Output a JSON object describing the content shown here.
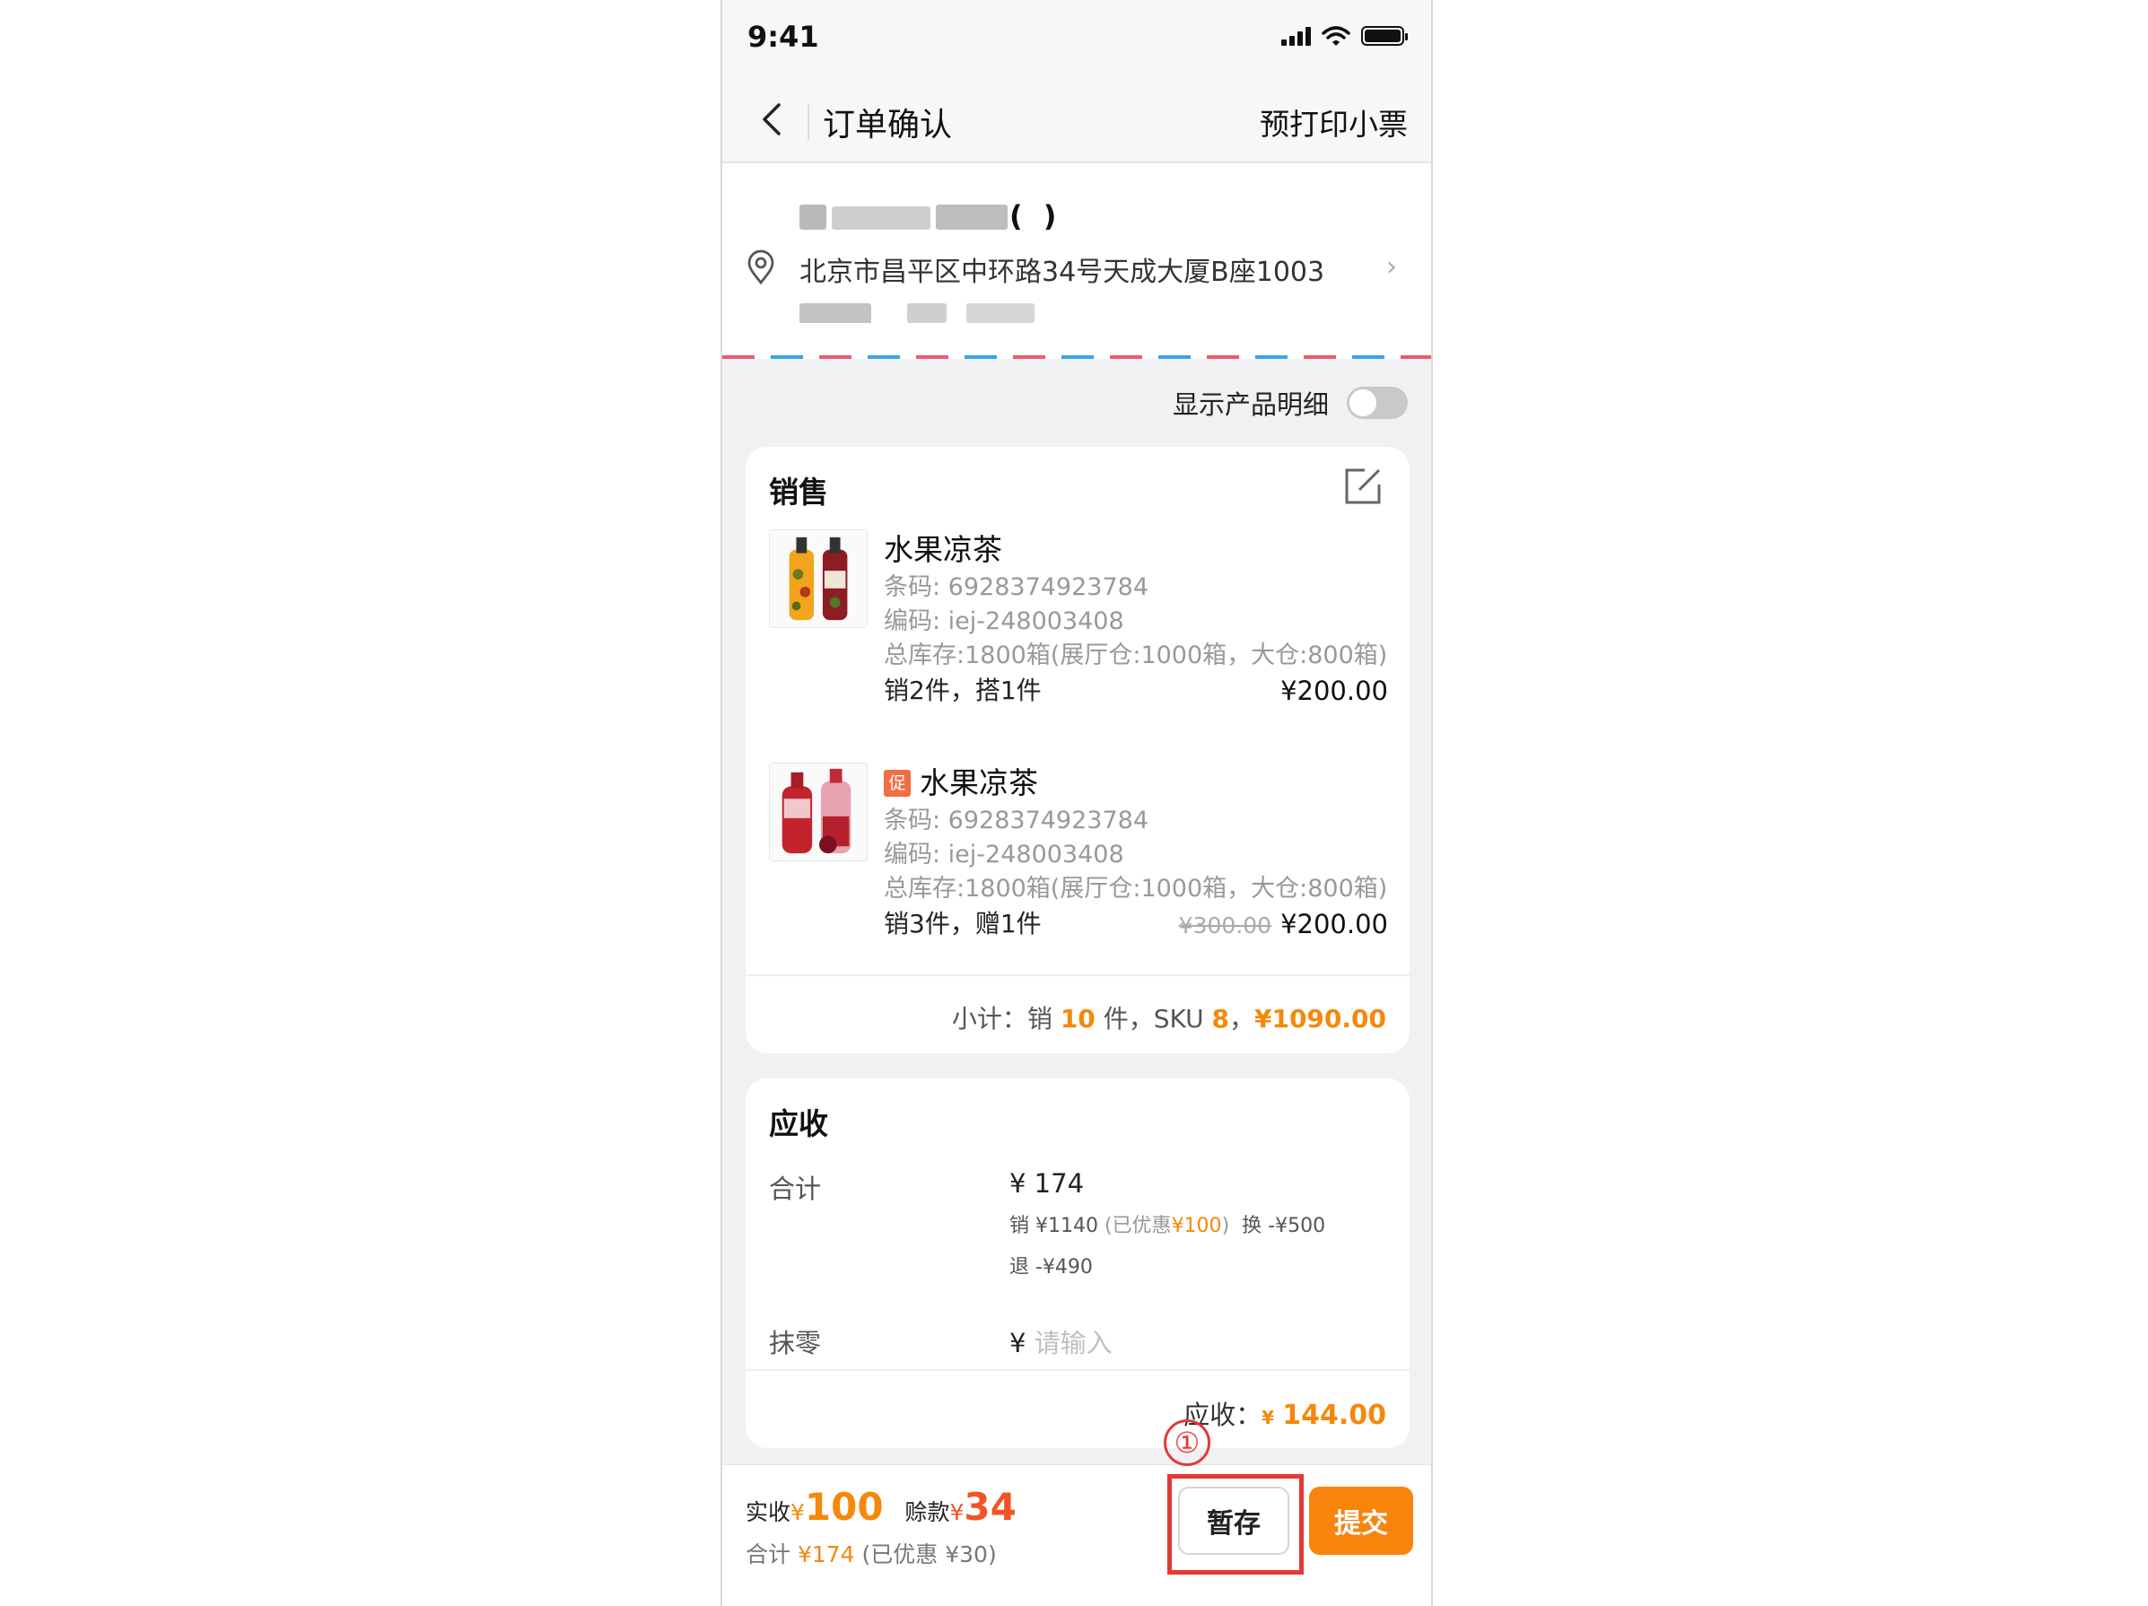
{
  "status_bar": {
    "time": "9:41"
  },
  "nav": {
    "title": "订单确认",
    "right_action": "预打印小票"
  },
  "address": {
    "name_visible": "(  )",
    "line": "北京市昌平区中环路34号天成大厦B座1003"
  },
  "toggle": {
    "label": "显示产品明细",
    "on": false
  },
  "sales": {
    "title": "销售",
    "products": [
      {
        "name": "水果凉茶",
        "promo": false,
        "barcode": "条码: 6928374923784",
        "code": "编码: iej-248003408",
        "stock": "总库存:1800箱(展厅仓:1000箱，大仓:800箱)",
        "qty": "销2件，搭1件",
        "old_price": "",
        "price": "¥200.00"
      },
      {
        "name": "水果凉茶",
        "promo": true,
        "promo_label": "促",
        "barcode": "条码: 6928374923784",
        "code": "编码: iej-248003408",
        "stock": "总库存:1800箱(展厅仓:1000箱，大仓:800箱)",
        "qty": "销3件，赠1件",
        "old_price": "¥300.00",
        "price": "¥200.00"
      }
    ],
    "subtotal": {
      "prefix": "小计：销 ",
      "qty": "10",
      "mid": " 件，SKU ",
      "sku": "8",
      "sep": "，",
      "amount": "¥1090.00"
    }
  },
  "receivable": {
    "title": "应收",
    "total_label": "合计",
    "total_value": "¥ 174",
    "detail_sale": "销 ¥1140",
    "detail_discount_open": " (已优惠",
    "detail_discount_amount": "¥100",
    "detail_discount_close": ")",
    "detail_exchange": "换 -¥500",
    "detail_return": "退 -¥490",
    "round_label": "抹零",
    "round_currency": "¥",
    "round_placeholder": "请输入",
    "due_label": "应收：",
    "due_currency": "¥",
    "due_amount": "144.00"
  },
  "annotation": {
    "marker": "①"
  },
  "bottom": {
    "received_label": "实收",
    "received_currency": "¥",
    "received_amount": "100",
    "credit_label": "赊款",
    "credit_currency": "¥",
    "credit_amount": "34",
    "total_label": "合计",
    "total_amount": "¥174",
    "total_discount": "(已优惠 ¥30)",
    "save_label": "暂存",
    "submit_label": "提交"
  },
  "colors": {
    "accent": "#f7850d",
    "red": "#e53935",
    "credit": "#f25324"
  }
}
